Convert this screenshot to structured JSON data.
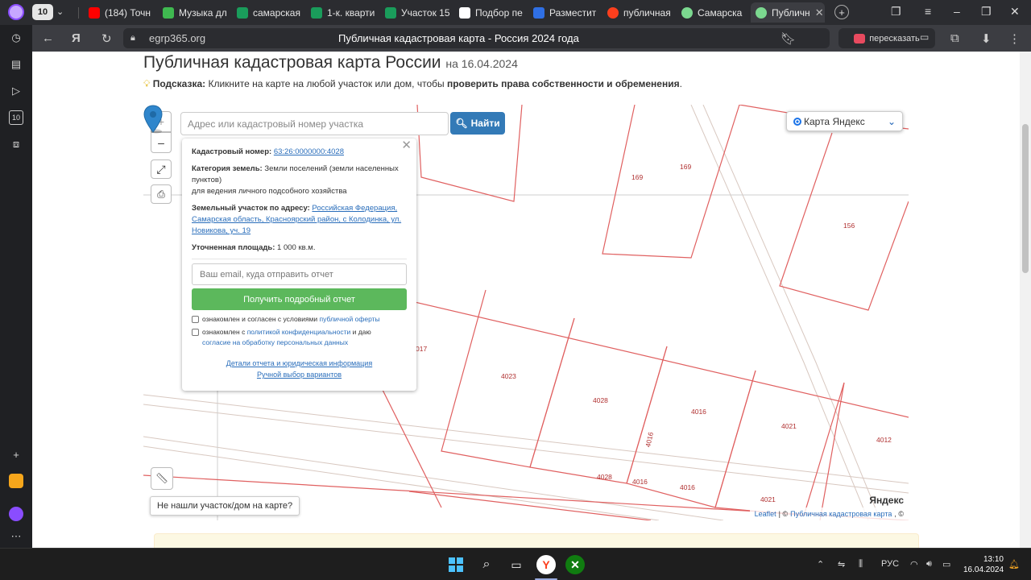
{
  "browser": {
    "tab_counter": "10",
    "tabs": [
      {
        "label": "(184) Точн",
        "color": "#ff0000"
      },
      {
        "label": "Музыка дл",
        "color": "#3fb950"
      },
      {
        "label": "самарская",
        "color": "#1a9c5b"
      },
      {
        "label": "1-к. кварти",
        "color": "#1a9c5b"
      },
      {
        "label": "Участок 15",
        "color": "#1a9c5b"
      },
      {
        "label": "Подбор пе",
        "color": "#ffffff"
      },
      {
        "label": "Разместит",
        "color": "#2f6fe4"
      },
      {
        "label": "публичная",
        "color": "#fc3f1d"
      },
      {
        "label": "Самарска",
        "color": "#7bd88f"
      },
      {
        "label": "Публичн",
        "color": "#7bd88f"
      }
    ],
    "new_tab": "+",
    "url": "egrp365.org",
    "page_title": "Публичная кадастровая карта - Россия 2024 года",
    "retell_label": "пересказать"
  },
  "page": {
    "title": "Публичная кадастровая карта России",
    "title_date": "на 16.04.2024",
    "hint_label": "Подсказка:",
    "hint_text": " Кликните на карте на любой участок или дом, чтобы ",
    "hint_bold": "проверить права собственности и обременения",
    "hint_end": "."
  },
  "map": {
    "zoom_in": "+",
    "zoom_out": "–",
    "search_placeholder": "Адрес или кадастровый номер участка",
    "find_label": "Найти",
    "layer_label": "Карта Яндекс",
    "not_found_label": "Не нашли участок/дом на карте?",
    "attribution_leaflet": "Leaflet",
    "attribution_sep": " | © ",
    "attribution_pkk": "Публичная кадастровая карта",
    "attribution_end": ", ©",
    "yandex_logo": "Яндекс",
    "parcel_labels": [
      "169",
      "169",
      "156",
      "017",
      "4023",
      "4028",
      "4016",
      "4016",
      "4021",
      "4012",
      "4028",
      "4016",
      "4016",
      "4021"
    ]
  },
  "popup": {
    "cadnum_label": "Кадастровый номер:",
    "cadnum_value": "63:26:0000000:4028",
    "category_label": "Категория земель:",
    "category_value": "Земли поселений (земли населенных пунктов)",
    "category_extra": "для ведения личного подсобного хозяйства",
    "address_label": "Земельный участок по адресу:",
    "address_value": "Российская Федерация, Самарская область, Красноярский район, с Колодинка, ул. Новикова, уч. 19",
    "area_label": "Уточненная площадь:",
    "area_value": "1 000 кв.м.",
    "email_placeholder": "Ваш email, куда отправить отчет",
    "report_button": "Получить подробный отчет",
    "agree1_text": "ознакомлен и согласен с условиями ",
    "agree1_link": "публичной оферты",
    "agree2_text": "ознакомлен с ",
    "agree2_link": "политикой конфиденциальности",
    "agree2_mid": " и даю ",
    "agree2_link2": "согласие на обработку персональных данных",
    "details_link": "Детали отчета и юридическая информация",
    "manual_link": "Ручной выбор вариантов"
  },
  "taskbar": {
    "lang": "РУС",
    "time": "13:10",
    "date": "16.04.2024"
  }
}
